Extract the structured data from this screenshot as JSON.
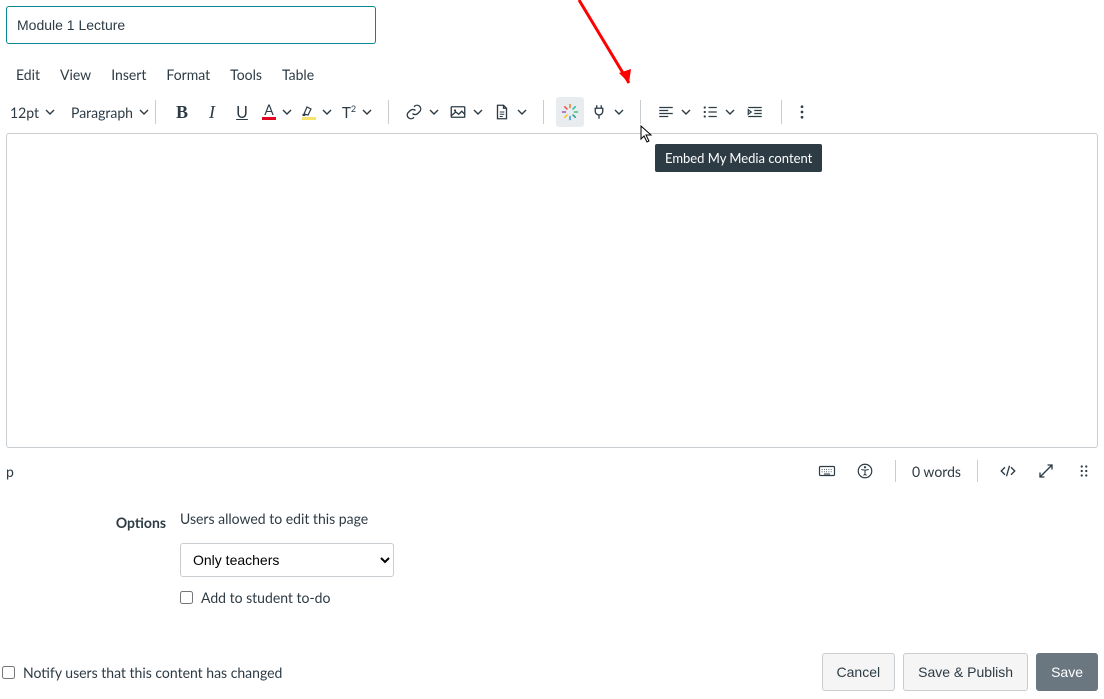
{
  "title_input": {
    "value": "Module 1 Lecture"
  },
  "menubar": {
    "edit": "Edit",
    "view": "View",
    "insert": "Insert",
    "format": "Format",
    "tools": "Tools",
    "table": "Table"
  },
  "toolbar": {
    "font_size": "12pt",
    "paragraph": "Paragraph"
  },
  "tooltip": "Embed My Media content",
  "statusbar": {
    "path": "p",
    "words": "0 words"
  },
  "options": {
    "label": "Options",
    "users_label": "Users allowed to edit this page",
    "select_value": "Only teachers",
    "todo_label": "Add to student to-do"
  },
  "notify_label": "Notify users that this content has changed",
  "buttons": {
    "cancel": "Cancel",
    "save_publish": "Save & Publish",
    "save": "Save"
  }
}
